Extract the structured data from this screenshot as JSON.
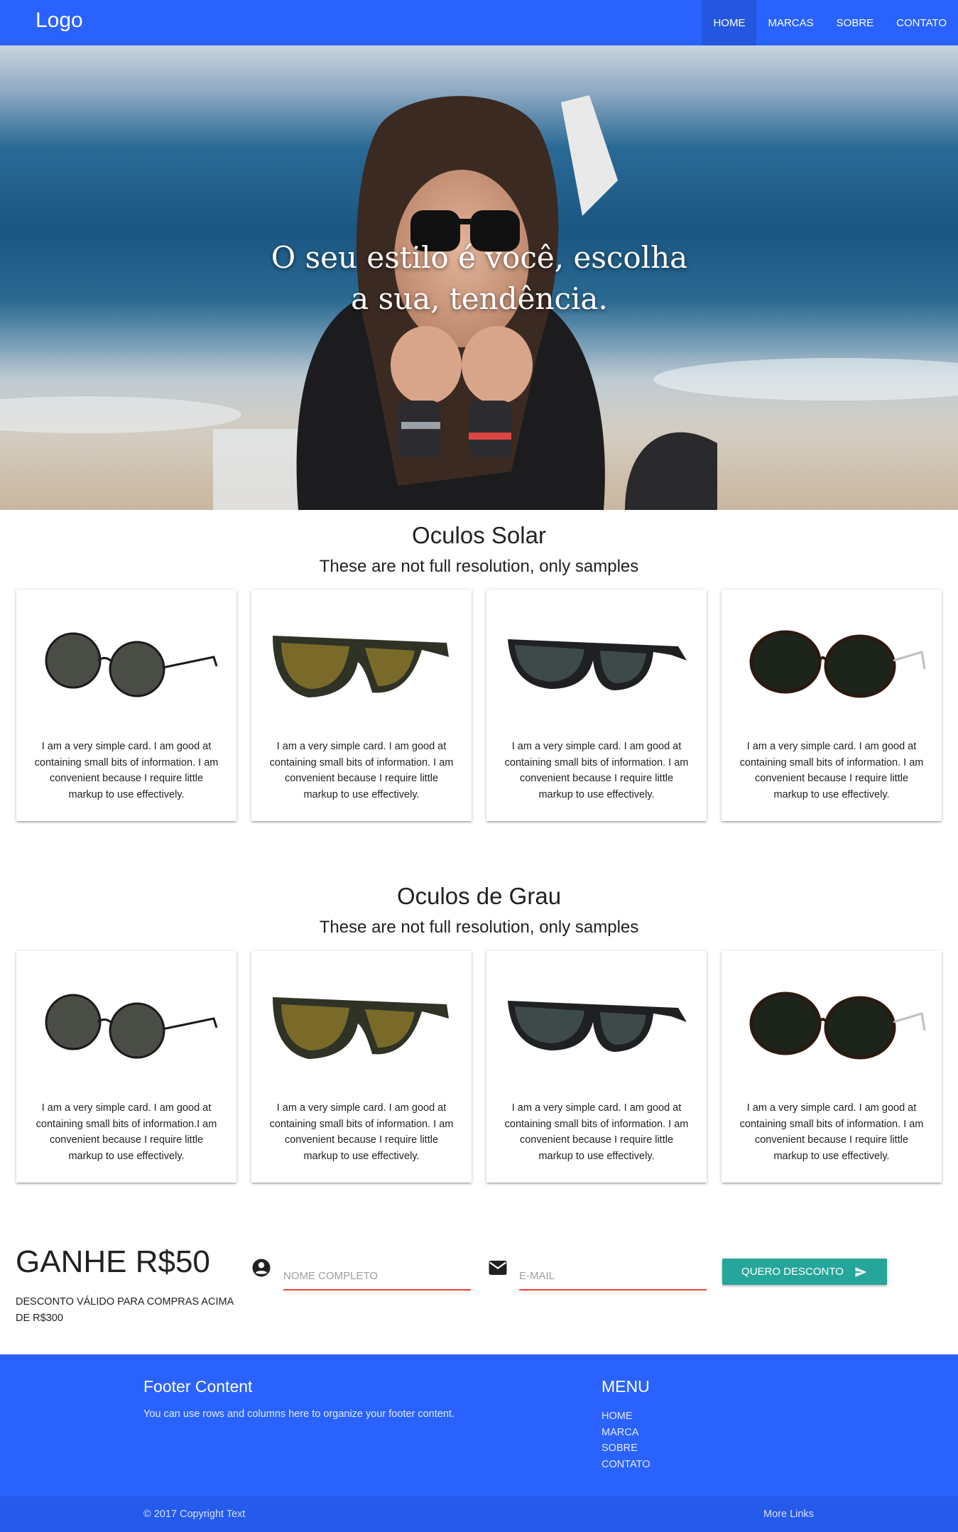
{
  "nav": {
    "logo": "Logo",
    "links": [
      "HOME",
      "MARCAS",
      "SOBRE",
      "CONTATO"
    ],
    "active": "HOME",
    "color": "#2962ff"
  },
  "hero": {
    "title": "O seu estilo é você, escolha a sua, tendência."
  },
  "sections": [
    {
      "title": "Oculos Solar",
      "subtitle": "These are not full resolution, only samples",
      "cards": [
        {
          "text": "I am a very simple card. I am good at containing small bits of information. I am convenient because I require little markup to use effectively."
        },
        {
          "text": "I am a very simple card. I am good at containing small bits of information. I am convenient because I require little markup to use effectively."
        },
        {
          "text": "I am a very simple card. I am good at containing small bits of information. I am convenient because I require little markup to use effectively."
        },
        {
          "text": "I am a very simple card. I am good at containing small bits of information. I am convenient because I require little markup to use effectively."
        }
      ]
    },
    {
      "title": "Oculos de Grau",
      "subtitle": "These are not full resolution, only samples",
      "cards": [
        {
          "text": "I am a very simple card. I am good at containing small bits of information.I am convenient because I require little markup to use effectively."
        },
        {
          "text": "I am a very simple card. I am good at containing small bits of information. I am convenient because I require little markup to use effectively."
        },
        {
          "text": "I am a very simple card. I am good at containing small bits of information. I am convenient because I require little markup to use effectively."
        },
        {
          "text": "I am a very simple card. I am good at containing small bits of information. I am convenient because I require little markup to use effectively."
        }
      ]
    }
  ],
  "promo": {
    "title": "GANHE R$50",
    "description": "DESCONTO VÁLIDO PARA COMPRAS ACIMA DE R$300",
    "name_placeholder": "NOME COMPLETO",
    "email_placeholder": "E-MAIL",
    "button_label": "QUERO DESCONTO",
    "button_color": "#26a69a",
    "underline_color": "#f44336"
  },
  "footer": {
    "title": "Footer Content",
    "text": "You can use rows and columns here to organize your footer content.",
    "menu_title": "MENU",
    "menu_items": [
      "HOME",
      "MARCA",
      "SOBRE",
      "CONTATO"
    ],
    "copyright": "© 2017 Copyright Text",
    "more_links": "More Links"
  }
}
